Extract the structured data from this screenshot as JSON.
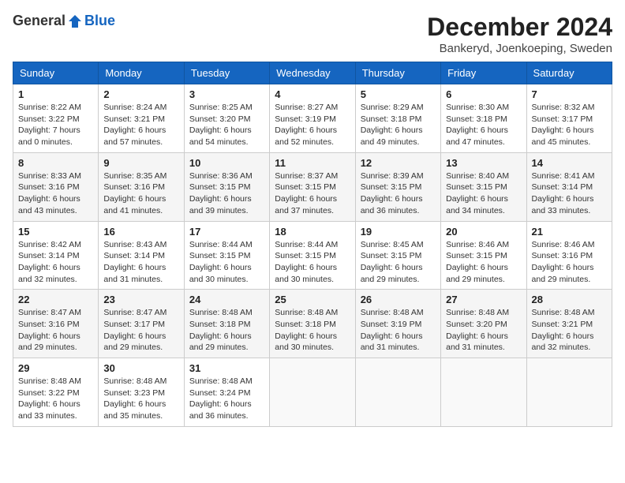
{
  "header": {
    "logo_general": "General",
    "logo_blue": "Blue",
    "month_title": "December 2024",
    "location": "Bankeryd, Joenkoeping, Sweden"
  },
  "weekdays": [
    "Sunday",
    "Monday",
    "Tuesday",
    "Wednesday",
    "Thursday",
    "Friday",
    "Saturday"
  ],
  "weeks": [
    [
      {
        "day": "1",
        "sunrise": "8:22 AM",
        "sunset": "3:22 PM",
        "daylight": "7 hours and 0 minutes."
      },
      {
        "day": "2",
        "sunrise": "8:24 AM",
        "sunset": "3:21 PM",
        "daylight": "6 hours and 57 minutes."
      },
      {
        "day": "3",
        "sunrise": "8:25 AM",
        "sunset": "3:20 PM",
        "daylight": "6 hours and 54 minutes."
      },
      {
        "day": "4",
        "sunrise": "8:27 AM",
        "sunset": "3:19 PM",
        "daylight": "6 hours and 52 minutes."
      },
      {
        "day": "5",
        "sunrise": "8:29 AM",
        "sunset": "3:18 PM",
        "daylight": "6 hours and 49 minutes."
      },
      {
        "day": "6",
        "sunrise": "8:30 AM",
        "sunset": "3:18 PM",
        "daylight": "6 hours and 47 minutes."
      },
      {
        "day": "7",
        "sunrise": "8:32 AM",
        "sunset": "3:17 PM",
        "daylight": "6 hours and 45 minutes."
      }
    ],
    [
      {
        "day": "8",
        "sunrise": "8:33 AM",
        "sunset": "3:16 PM",
        "daylight": "6 hours and 43 minutes."
      },
      {
        "day": "9",
        "sunrise": "8:35 AM",
        "sunset": "3:16 PM",
        "daylight": "6 hours and 41 minutes."
      },
      {
        "day": "10",
        "sunrise": "8:36 AM",
        "sunset": "3:15 PM",
        "daylight": "6 hours and 39 minutes."
      },
      {
        "day": "11",
        "sunrise": "8:37 AM",
        "sunset": "3:15 PM",
        "daylight": "6 hours and 37 minutes."
      },
      {
        "day": "12",
        "sunrise": "8:39 AM",
        "sunset": "3:15 PM",
        "daylight": "6 hours and 36 minutes."
      },
      {
        "day": "13",
        "sunrise": "8:40 AM",
        "sunset": "3:15 PM",
        "daylight": "6 hours and 34 minutes."
      },
      {
        "day": "14",
        "sunrise": "8:41 AM",
        "sunset": "3:14 PM",
        "daylight": "6 hours and 33 minutes."
      }
    ],
    [
      {
        "day": "15",
        "sunrise": "8:42 AM",
        "sunset": "3:14 PM",
        "daylight": "6 hours and 32 minutes."
      },
      {
        "day": "16",
        "sunrise": "8:43 AM",
        "sunset": "3:14 PM",
        "daylight": "6 hours and 31 minutes."
      },
      {
        "day": "17",
        "sunrise": "8:44 AM",
        "sunset": "3:15 PM",
        "daylight": "6 hours and 30 minutes."
      },
      {
        "day": "18",
        "sunrise": "8:44 AM",
        "sunset": "3:15 PM",
        "daylight": "6 hours and 30 minutes."
      },
      {
        "day": "19",
        "sunrise": "8:45 AM",
        "sunset": "3:15 PM",
        "daylight": "6 hours and 29 minutes."
      },
      {
        "day": "20",
        "sunrise": "8:46 AM",
        "sunset": "3:15 PM",
        "daylight": "6 hours and 29 minutes."
      },
      {
        "day": "21",
        "sunrise": "8:46 AM",
        "sunset": "3:16 PM",
        "daylight": "6 hours and 29 minutes."
      }
    ],
    [
      {
        "day": "22",
        "sunrise": "8:47 AM",
        "sunset": "3:16 PM",
        "daylight": "6 hours and 29 minutes."
      },
      {
        "day": "23",
        "sunrise": "8:47 AM",
        "sunset": "3:17 PM",
        "daylight": "6 hours and 29 minutes."
      },
      {
        "day": "24",
        "sunrise": "8:48 AM",
        "sunset": "3:18 PM",
        "daylight": "6 hours and 29 minutes."
      },
      {
        "day": "25",
        "sunrise": "8:48 AM",
        "sunset": "3:18 PM",
        "daylight": "6 hours and 30 minutes."
      },
      {
        "day": "26",
        "sunrise": "8:48 AM",
        "sunset": "3:19 PM",
        "daylight": "6 hours and 31 minutes."
      },
      {
        "day": "27",
        "sunrise": "8:48 AM",
        "sunset": "3:20 PM",
        "daylight": "6 hours and 31 minutes."
      },
      {
        "day": "28",
        "sunrise": "8:48 AM",
        "sunset": "3:21 PM",
        "daylight": "6 hours and 32 minutes."
      }
    ],
    [
      {
        "day": "29",
        "sunrise": "8:48 AM",
        "sunset": "3:22 PM",
        "daylight": "6 hours and 33 minutes."
      },
      {
        "day": "30",
        "sunrise": "8:48 AM",
        "sunset": "3:23 PM",
        "daylight": "6 hours and 35 minutes."
      },
      {
        "day": "31",
        "sunrise": "8:48 AM",
        "sunset": "3:24 PM",
        "daylight": "6 hours and 36 minutes."
      },
      null,
      null,
      null,
      null
    ]
  ],
  "labels": {
    "sunrise": "Sunrise:",
    "sunset": "Sunset:",
    "daylight": "Daylight:"
  }
}
